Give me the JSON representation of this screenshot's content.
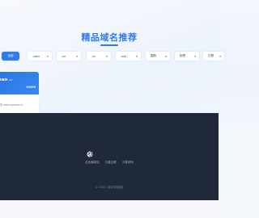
{
  "section": {
    "title": "精品域名推荐"
  },
  "filters": [
    {
      "label": "全部",
      "active": true
    },
    {
      "label": ".com",
      "has_dropdown": true
    },
    {
      "label": ".cn",
      "has_dropdown": true
    },
    {
      "label": ".cc",
      "has_dropdown": true
    },
    {
      "label": ".net",
      "has_dropdown": true
    },
    {
      "label": "国际",
      "has_dropdown": true
    },
    {
      "label": "标签",
      "has_dropdown": true
    },
    {
      "label": "已售",
      "has_dropdown": true
    }
  ],
  "domain_card": {
    "name": "mao",
    "tld": ".cn",
    "price": "¥1699",
    "url": "查 www.gumao.cn"
  },
  "footer": {
    "links": [
      "企业微网站",
      "万象互联",
      "万象好码"
    ],
    "copyright": "© 2025 | 域名市场官网"
  },
  "colors": {
    "accent": "#2f7be9",
    "footer_bg": "#20293a"
  },
  "icons": {
    "globe": "globe-icon"
  }
}
